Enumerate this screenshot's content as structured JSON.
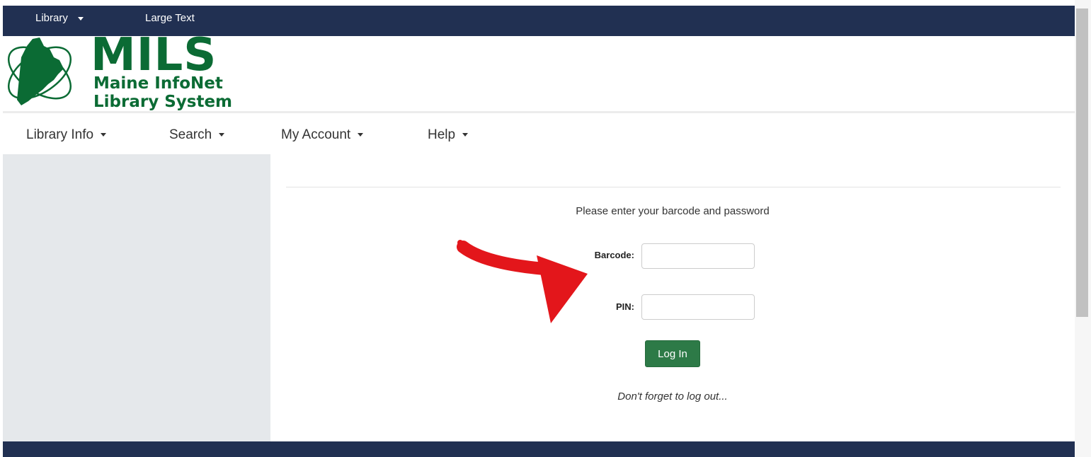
{
  "topbar": {
    "library_label": "Library",
    "large_text_label": "Large Text"
  },
  "logo": {
    "title": "MILS",
    "line1": "Maine InfoNet",
    "line2": "Library System"
  },
  "nav": [
    {
      "label": "Library Info"
    },
    {
      "label": "Search"
    },
    {
      "label": "My Account"
    },
    {
      "label": "Help"
    }
  ],
  "login": {
    "prompt": "Please enter your barcode and password",
    "barcode_label": "Barcode:",
    "barcode_value": "",
    "pin_label": "PIN:",
    "pin_value": "",
    "button_label": "Log In",
    "note": "Don't forget to log out..."
  },
  "colors": {
    "navy": "#213052",
    "green": "#0b6b34",
    "button_green": "#2d7a47",
    "arrow_red": "#e3161b"
  },
  "icons": {
    "logo_mark": "maine-map-orbit-icon",
    "annotation": "red-arrow-icon",
    "dropdown": "caret-down-icon"
  }
}
